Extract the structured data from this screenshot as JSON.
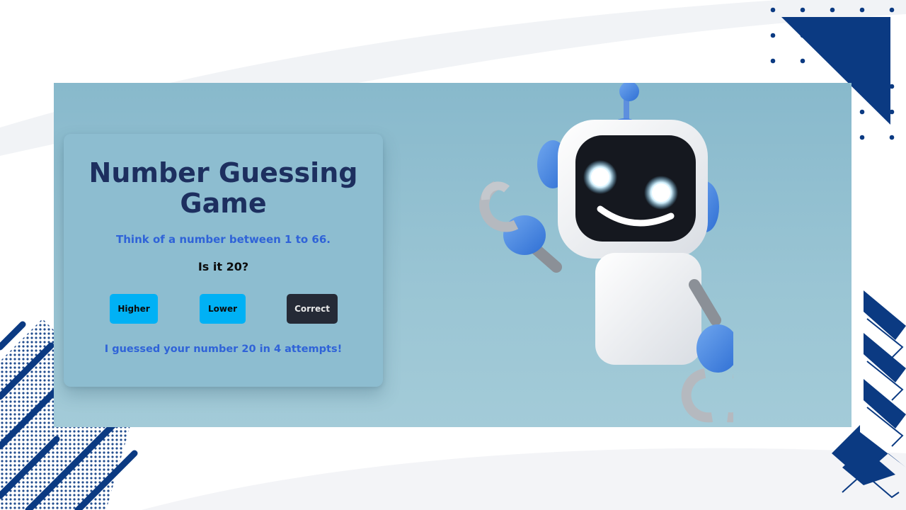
{
  "game": {
    "title": "Number Guessing Game",
    "prompt": "Think of a number between 1 to 66.",
    "question": "Is it 20?",
    "buttons": {
      "higher": "Higher",
      "lower": "Lower",
      "correct": "Correct"
    },
    "result": "I guessed your number 20 in 4 attempts!"
  },
  "colors": {
    "title": "#1d2f5f",
    "accent_text": "#2f63d8",
    "button_primary": "#00b1f5",
    "button_dark": "#252a36",
    "decoration": "#0b3a82"
  },
  "icons": {
    "illustration": "robot-mascot-illustration"
  }
}
